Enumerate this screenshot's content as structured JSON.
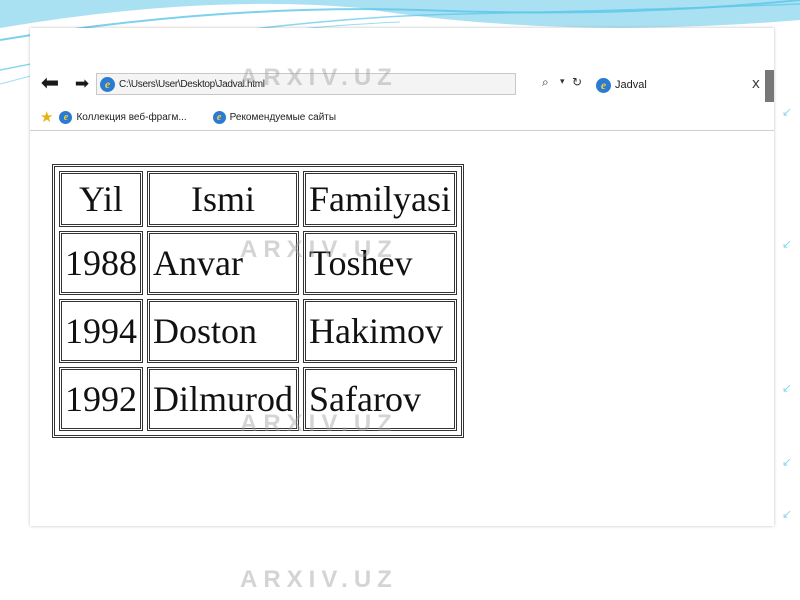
{
  "browser": {
    "address_url": "C:\\Users\\User\\Desktop\\Jadval.html",
    "tab_title": "Jadval",
    "tab_close": "x",
    "nav_back": "⬅",
    "nav_forward": "➡",
    "search_icon_glyph": "⌕",
    "dropdown_glyph": "▾",
    "refresh_glyph": "↻",
    "ie_glyph": "e"
  },
  "favorites": {
    "star_glyph": "★",
    "items": [
      {
        "label": "Коллекция веб-фрагм...",
        "icon": "ie-icon"
      },
      {
        "label": "Рекомендуемые сайты",
        "icon": "ie-icon"
      }
    ]
  },
  "table": {
    "headers": [
      "Yil",
      "Ismi",
      "Familyasi"
    ],
    "rows": [
      [
        "1988",
        "Anvar",
        "Toshev"
      ],
      [
        "1994",
        "Doston",
        "Hakimov"
      ],
      [
        "1992",
        "Dilmurod",
        "Safarov"
      ]
    ]
  },
  "watermark": "ARXIV.UZ",
  "colors": {
    "slide_accent": "#5bc6e8",
    "ie_blue": "#2a7bd3",
    "favorites_star": "#e3b317"
  }
}
